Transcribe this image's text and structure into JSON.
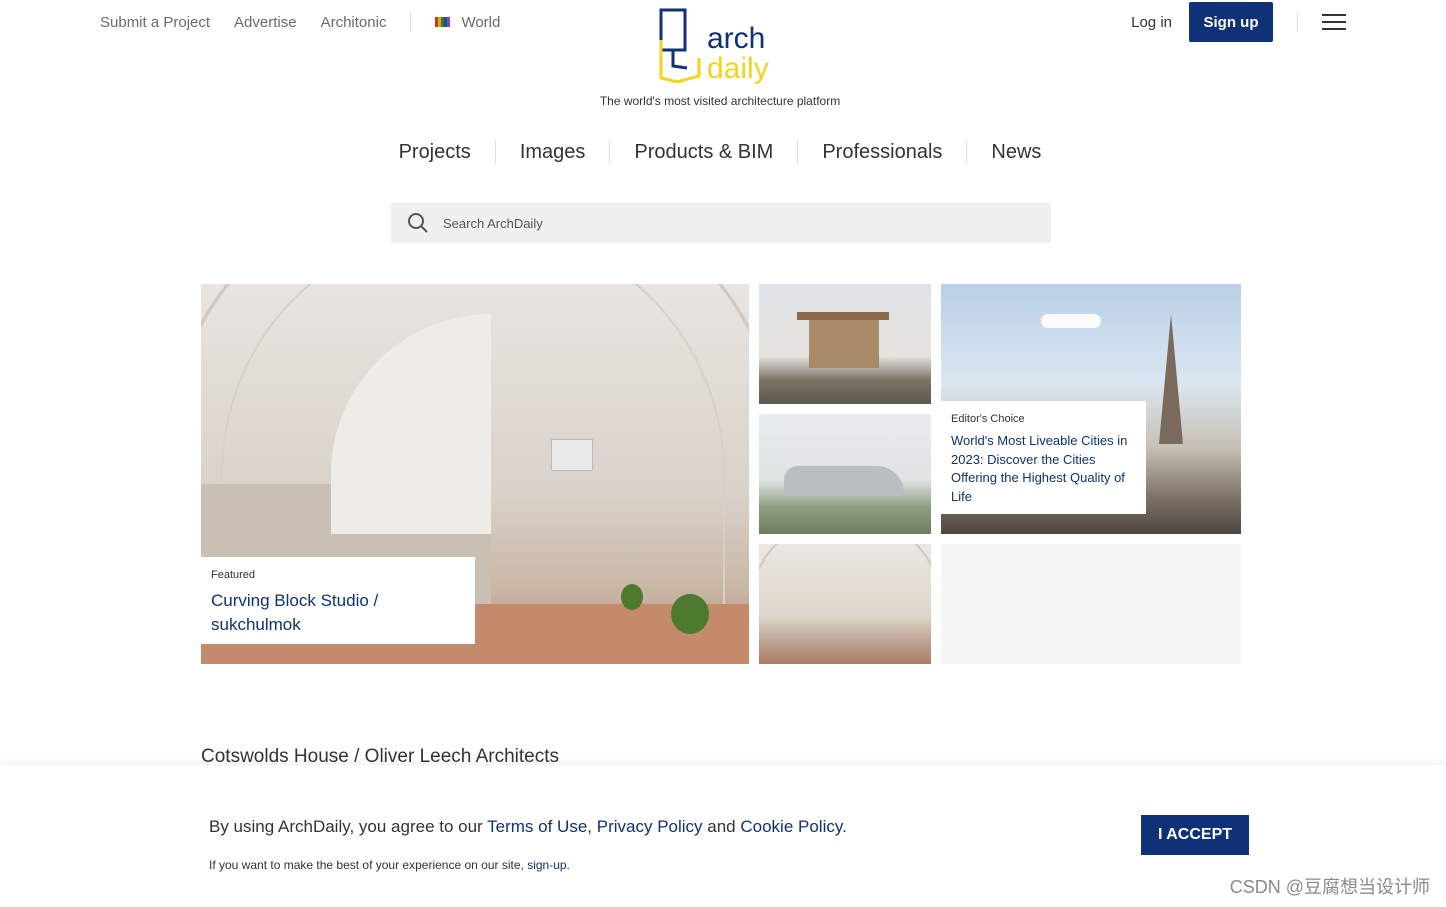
{
  "topbar": {
    "links": [
      "Submit a Project",
      "Advertise",
      "Architonic"
    ],
    "region": "World",
    "flag_colors": [
      "#c0392b",
      "#e0b000",
      "#2e7d32",
      "#1f4e9c",
      "#8e44ad"
    ]
  },
  "brand": {
    "logo_top": "arch",
    "logo_bottom": "daily",
    "tagline": "The world's most visited architecture platform",
    "colors": {
      "primary": "#0f3177",
      "accent": "#f4d21f"
    }
  },
  "auth": {
    "login": "Log in",
    "signup": "Sign up"
  },
  "main_nav": [
    "Projects",
    "Images",
    "Products & BIM",
    "Professionals",
    "News"
  ],
  "search": {
    "placeholder": "Search ArchDaily"
  },
  "featured": {
    "label": "Featured",
    "title": "Curving Block Studio / sukchulmok"
  },
  "editors_choice": {
    "label": "Editor's Choice",
    "title": "World's Most Liveable Cities in 2023: Discover the Cities Offering the Highest Quality of Life"
  },
  "next_article_title": "Cotswolds House / Oliver Leech Architects",
  "cookie": {
    "text_before": "By using ArchDaily, you agree to our ",
    "terms": "Terms of Use",
    "comma": ", ",
    "privacy": "Privacy Policy",
    "and": " and ",
    "cookie_policy": "Cookie Policy",
    "period": ".",
    "sub_before": "If you want to make the best of your experience on our site, ",
    "sub_link": "sign-up",
    "sub_after": ".",
    "accept": "I ACCEPT"
  },
  "watermark": "CSDN @豆腐想当设计师"
}
